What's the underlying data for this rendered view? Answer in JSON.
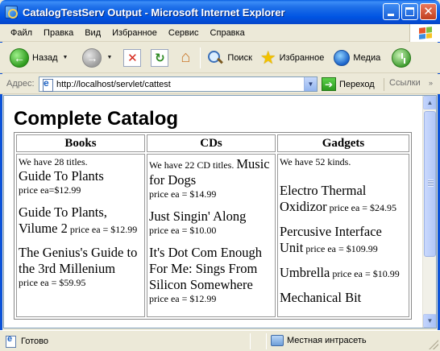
{
  "window": {
    "title": "CatalogTestServ Output - Microsoft Internet Explorer"
  },
  "menu": [
    {
      "label": "Файл"
    },
    {
      "label": "Правка"
    },
    {
      "label": "Вид"
    },
    {
      "label": "Избранное"
    },
    {
      "label": "Сервис"
    },
    {
      "label": "Справка"
    }
  ],
  "toolbar": {
    "back_label": "Назад",
    "search_label": "Поиск",
    "favorites_label": "Избранное",
    "media_label": "Медиа"
  },
  "address": {
    "label": "Адрес:",
    "url": "http://localhost/servlet/cattest",
    "go_label": "Переход",
    "links_label": "Ссылки"
  },
  "page": {
    "title": "Complete Catalog",
    "columns": [
      "Books",
      "CDs",
      "Gadgets"
    ],
    "books": {
      "intro": "We have 28 titles.",
      "items": [
        {
          "name": "Guide To Plants",
          "price": "price ea=$12.99"
        },
        {
          "name": "Guide To Plants, Vilume 2",
          "price": "price ea = $12.99"
        },
        {
          "name": "The Genius's Guide to the 3rd Millenium",
          "price": "price ea = $59.95"
        }
      ]
    },
    "cds": {
      "intro": "We have 22 CD titles.",
      "items": [
        {
          "name": "Music for Dogs",
          "price": "price ea = $14.99"
        },
        {
          "name": "Just Singin' Along",
          "price": "price ea = $10.00"
        },
        {
          "name": "It's Dot Com Enough For Me: Sings From Silicon Somewhere",
          "price": "price ea = $12.99"
        }
      ]
    },
    "gadgets": {
      "intro": "We have 52 kinds.",
      "items": [
        {
          "name": "Electro Thermal Oxidizor",
          "price": "price ea = $24.95"
        },
        {
          "name": "Percusive Interface Unit",
          "price": "price ea = $109.99"
        },
        {
          "name": "Umbrella",
          "price": "price ea = $10.99"
        },
        {
          "name": "Mechanical Bit",
          "price": ""
        }
      ]
    }
  },
  "status": {
    "text": "Готово",
    "zone": "Местная интрасеть"
  }
}
